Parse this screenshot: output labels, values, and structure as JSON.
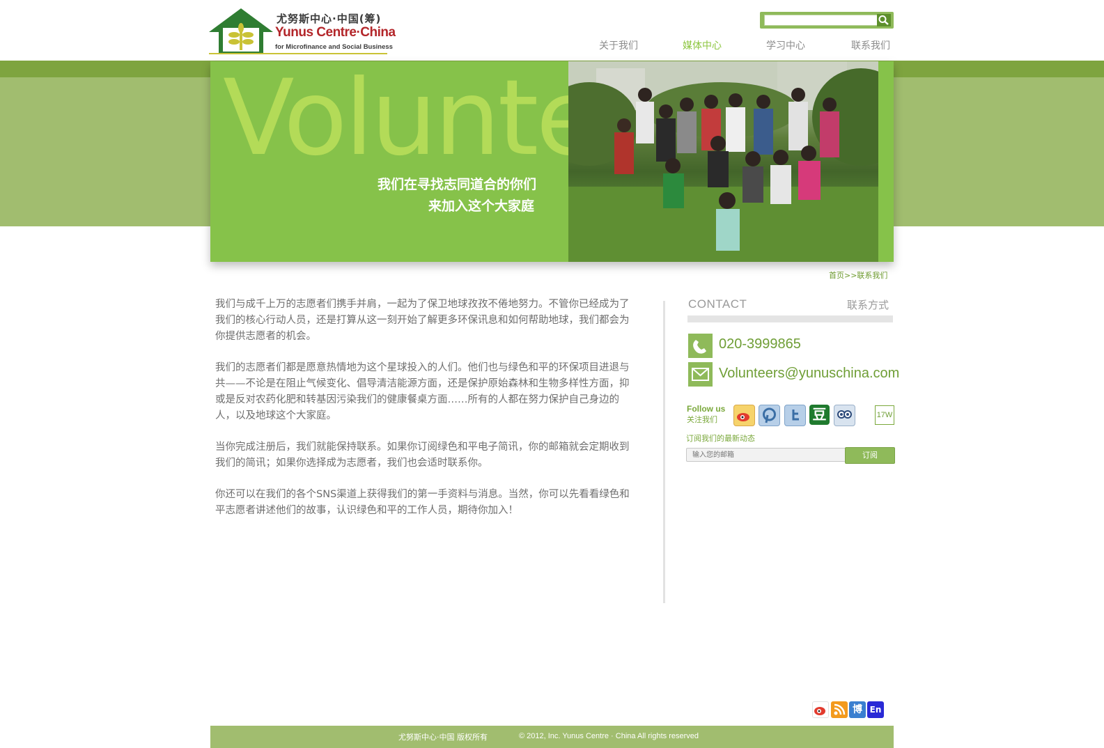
{
  "header": {
    "logo_cn": "尤努斯中心·中国(筹)",
    "logo_en": "Yunus Centre·China",
    "logo_sub": "for Microfinance and Social Business",
    "search": {
      "value": "",
      "placeholder": ""
    },
    "nav": [
      {
        "label": "关于我们"
      },
      {
        "label": "媒体中心",
        "active": true
      },
      {
        "label": "学习中心"
      },
      {
        "label": "联系我们"
      }
    ]
  },
  "banner": {
    "word": "Volunteer",
    "line1": "我们在寻找志同道合的你们",
    "line2": "来加入这个大家庭"
  },
  "breadcrumb": "首页>>联系我们",
  "content": {
    "paragraphs": [
      "我们与成千上万的志愿者们携手并肩，一起为了保卫地球孜孜不倦地努力。不管你已经成为了我们的核心行动人员，还是打算从这一刻开始了解更多环保讯息和如何帮助地球，我们都会为你提供志愿者的机会。",
      "我们的志愿者们都是愿意热情地为这个星球投入的人们。他们也与绿色和平的环保项目进退与共——不论是在阻止气候变化、倡导清洁能源方面，还是保护原始森林和生物多样性方面，抑或是反对农药化肥和转基因污染我们的健康餐桌方面……所有的人都在努力保护自己身边的人，以及地球这个大家庭。",
      "当你完成注册后，我们就能保持联系。如果你订阅绿色和平电子简讯，你的邮箱就会定期收到我们的简讯；如果你选择成为志愿者，我们也会适时联系你。",
      "你还可以在我们的各个SNS渠道上获得我们的第一手资料与消息。当然，你可以先看看绿色和平志愿者讲述他们的故事，认识绿色和平的工作人员，期待你加入！"
    ]
  },
  "sidebar": {
    "contact_en": "CONTACT",
    "contact_cn": "联系方式",
    "phone": "020-3999865",
    "email": "Volunteers@yunuschina.com",
    "follow_en": "Follow us",
    "follow_cn": "关注我们",
    "sns_icons": [
      "weibo-icon",
      "pinterest-icon",
      "twitter-icon",
      "douban-icon",
      "kaixin-icon"
    ],
    "douban_glyph": "豆",
    "fans": "17W",
    "subscribe_title": "订阅我们的最新动态",
    "subscribe_placeholder": "输入您的邮箱",
    "subscribe_button": "订阅"
  },
  "bottom_icons": {
    "icons": [
      "weibo-icon",
      "rss-icon",
      "blog-icon",
      "english-icon"
    ],
    "blog_glyph": "博",
    "english_glyph": "En"
  },
  "footer": {
    "copyright_cn": "尤努斯中心·中国 版权所有",
    "copyright_en": "©  2012, Inc. Yunus Centre · China    All rights reserved"
  },
  "colors": {
    "accent": "#86c24a",
    "dark_green": "#6f9e36",
    "band": "#a1bd6f"
  }
}
